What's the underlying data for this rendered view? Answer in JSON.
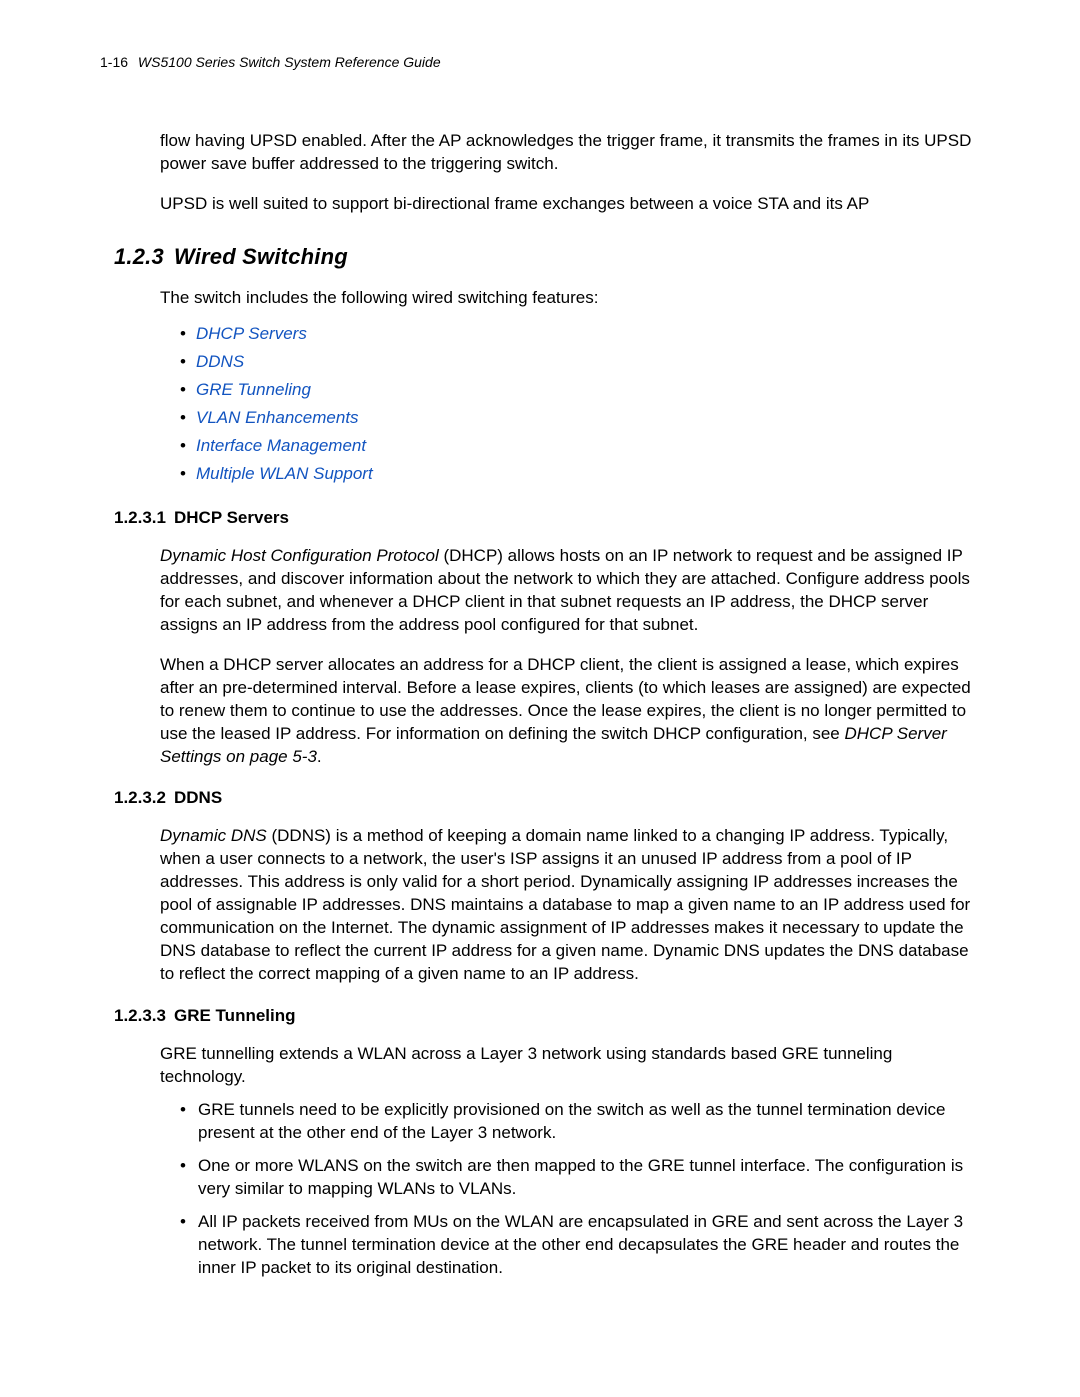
{
  "header": {
    "page_number": "1-16",
    "doc_title": "WS5100 Series Switch System Reference Guide"
  },
  "intro": {
    "para1": "flow having UPSD enabled. After the AP acknowledges the trigger frame, it transmits the frames in its UPSD power save buffer addressed to the triggering switch.",
    "para2": "UPSD is well suited to support bi-directional frame exchanges between a voice STA and its AP"
  },
  "sec_wired": {
    "number": "1.2.3",
    "title": "Wired Switching",
    "lead": "The switch includes the following wired switching features:",
    "links": [
      "DHCP Servers",
      "DDNS",
      "GRE Tunneling",
      "VLAN Enhancements",
      "Interface Management",
      "Multiple WLAN Support"
    ]
  },
  "sec_dhcp": {
    "number": "1.2.3.1",
    "title": "DHCP Servers",
    "lead_italic": "Dynamic Host Configuration Protocol",
    "para1_rest": " (DHCP) allows hosts on an IP network to request and be assigned IP addresses, and discover information about the network to which they are attached. Configure address pools for each subnet, and whenever a DHCP client in that subnet requests an IP address, the DHCP server assigns an IP address from the address pool configured for that subnet.",
    "para2": "When a DHCP server allocates an address for a DHCP client, the client is assigned a lease, which expires after an pre-determined interval. Before a lease expires, clients (to which leases are assigned) are expected to renew them to continue to use the addresses. Once the lease expires, the client is no longer permitted to use the leased IP address. For information on defining the switch DHCP configuration, see ",
    "para2_ref": "DHCP Server Settings on page 5-3",
    "para2_tail": "."
  },
  "sec_ddns": {
    "number": "1.2.3.2",
    "title": "DDNS",
    "lead_italic": "Dynamic DNS",
    "para1_rest": " (DDNS) is a method of keeping a domain name linked to a changing IP address. Typically, when a user connects to a network, the user's ISP assigns it an unused IP address from a pool of IP addresses. This address is only valid for a short period. Dynamically assigning IP addresses increases the pool of assignable IP addresses. DNS maintains a database to map a given name to an IP address used for communication on the Internet. The dynamic assignment of IP addresses makes it necessary to update the DNS database to reflect the current IP address for a given name. Dynamic DNS updates the DNS database to reflect the correct mapping of a given name to an IP address."
  },
  "sec_gre": {
    "number": "1.2.3.3",
    "title": "GRE Tunneling",
    "lead": "GRE tunnelling extends a WLAN across a Layer 3 network using standards based GRE tunneling technology.",
    "bullets": [
      "GRE tunnels need to be explicitly provisioned on the switch as well as the tunnel termination device present at the other end of the Layer 3 network.",
      "One or more WLANS on the switch are then mapped to the GRE tunnel interface. The configuration is very similar to mapping WLANs to VLANs.",
      "All IP packets received from MUs on the WLAN are encapsulated in GRE and sent across the Layer 3 network. The tunnel termination device at the other end decapsulates the GRE header and routes the inner IP packet to its original destination."
    ]
  }
}
